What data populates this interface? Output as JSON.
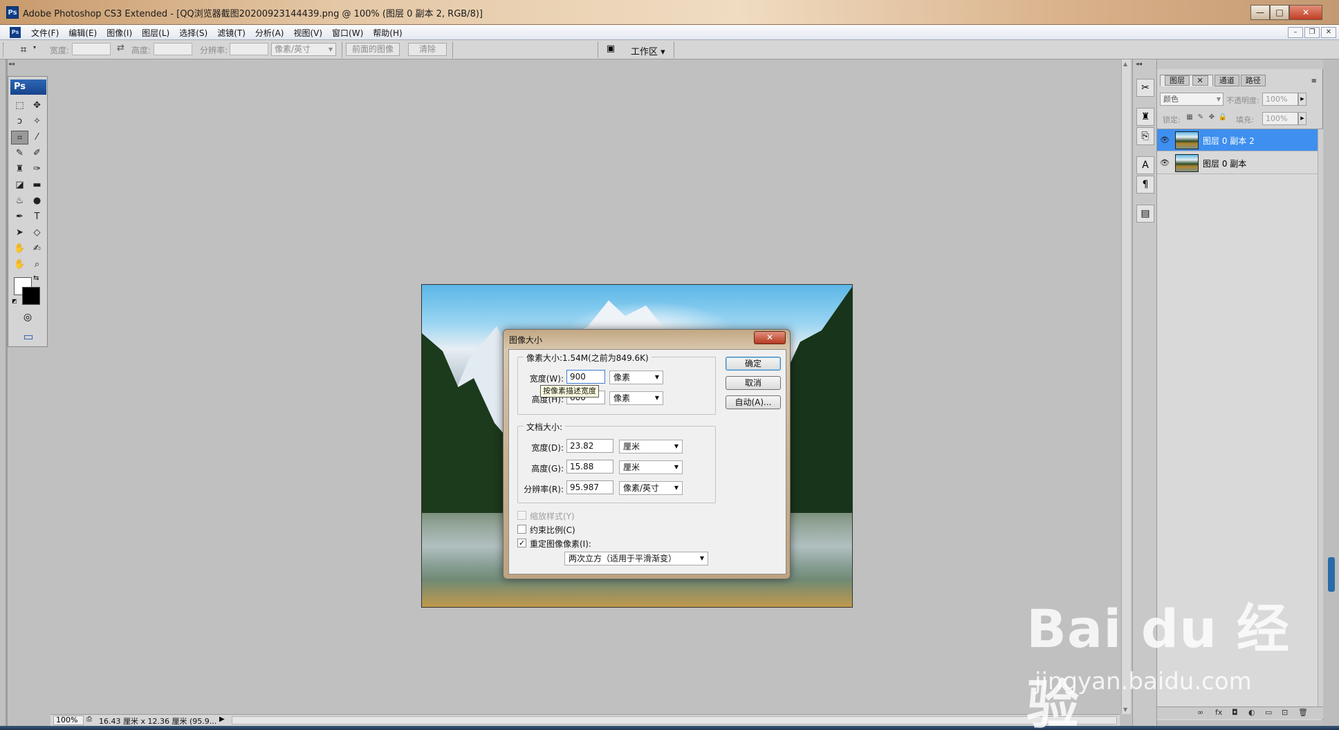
{
  "window": {
    "title": "Adobe Photoshop CS3 Extended - [QQ浏览器截图20200923144439.png @ 100% (图层 0 副本 2, RGB/8)]",
    "app_icon": "Ps",
    "minimize": "—",
    "maximize": "□",
    "close": "✕"
  },
  "menu": {
    "app_icon": "Ps",
    "items": [
      "文件(F)",
      "编辑(E)",
      "图像(I)",
      "图层(L)",
      "选择(S)",
      "滤镜(T)",
      "分析(A)",
      "视图(V)",
      "窗口(W)",
      "帮助(H)"
    ],
    "doc_buttons": [
      "–",
      "❐",
      "✕"
    ]
  },
  "options": {
    "width_label": "宽度:",
    "height_label": "高度:",
    "resolution_label": "分辨率:",
    "unit": "像素/英寸",
    "front_image": "前面的图像",
    "clear": "清除",
    "workspace": "工作区 ▾"
  },
  "toolbox": {
    "logo": "Ps",
    "tools": [
      "⬚",
      "✥",
      "ↄ",
      "✧",
      "⌗",
      "⁄",
      "✎",
      "✐",
      "♜",
      "✑",
      "◪",
      "▬",
      "♨",
      "●",
      "✒",
      "T",
      "➤",
      "◇",
      "✋",
      "✍",
      "✋",
      "⌕"
    ]
  },
  "statusbar": {
    "zoom": "100%",
    "doc_info": "16.43 厘米 x 12.36 厘米 (95.9...",
    "arrow": "▶"
  },
  "layers_panel": {
    "tabs": [
      "图层",
      "通道",
      "路径"
    ],
    "tab_close": "✕",
    "menu_icon": "≡",
    "blend_mode": "颜色",
    "opacity_label": "不透明度:",
    "opacity_value": "100%",
    "lock_label": "锁定:",
    "fill_label": "填充:",
    "fill_value": "100%",
    "layers": [
      {
        "name": "图层 0 副本 2",
        "selected": true
      },
      {
        "name": "图层 0 副本",
        "selected": false
      }
    ],
    "footer_icons": [
      "∞",
      "fx",
      "◘",
      "◐",
      "▭",
      "⊡",
      "🗑"
    ]
  },
  "dialog": {
    "title": "图像大小",
    "close": "✕",
    "pixel_group": "像素大小:1.54M(之前为849.6K)",
    "pixel_width_label": "宽度(W):",
    "pixel_width_value": "900",
    "pixel_width_unit": "像素",
    "pixel_height_label": "高度(H):",
    "pixel_height_value": "600",
    "pixel_height_unit": "像素",
    "tooltip": "按像素描述宽度",
    "doc_group": "文档大小:",
    "doc_width_label": "宽度(D):",
    "doc_width_value": "23.82",
    "doc_width_unit": "厘米",
    "doc_height_label": "高度(G):",
    "doc_height_value": "15.88",
    "doc_height_unit": "厘米",
    "resolution_label": "分辨率(R):",
    "resolution_value": "95.987",
    "resolution_unit": "像素/英寸",
    "scale_styles": "缩放样式(Y)",
    "constrain": "约束比例(C)",
    "resample": "重定图像像素(I):",
    "resample_method": "两次立方（适用于平滑渐变）",
    "ok": "确定",
    "cancel": "取消",
    "auto": "自动(A)..."
  },
  "watermark": {
    "brand": "Bai du 经验",
    "url": "jingyan.baidu.com"
  }
}
